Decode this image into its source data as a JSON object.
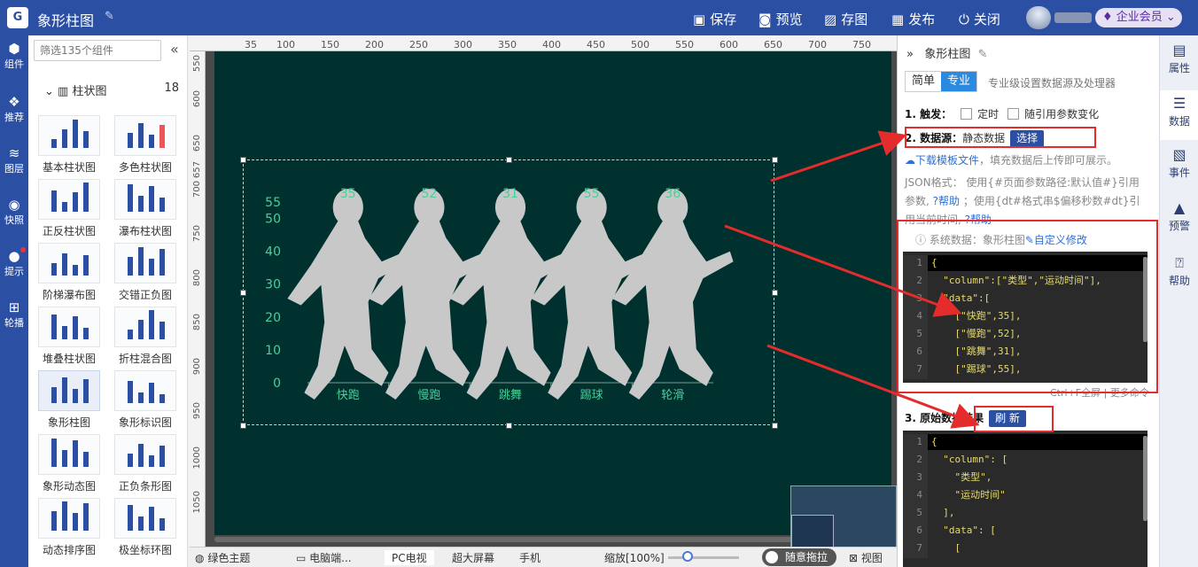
{
  "app": {
    "title": "象形柱图",
    "logo": "G"
  },
  "toolbar": {
    "save": "保存",
    "preview": "预览",
    "snapshot": "存图",
    "publish": "发布",
    "close": "关闭",
    "vip": "企业会员"
  },
  "leftnav": {
    "items": [
      "组件",
      "推荐",
      "图层",
      "快照",
      "提示",
      "轮播"
    ]
  },
  "palette": {
    "search_placeholder": "筛选135个组件",
    "group": "柱状图",
    "group_count": "18",
    "items": [
      "基本柱状图",
      "多色柱状图",
      "正反柱状图",
      "瀑布柱状图",
      "阶梯瀑布图",
      "交错正负图",
      "堆叠柱状图",
      "折柱混合图",
      "象形柱图",
      "象形标识图",
      "象形动态图",
      "正负条形图",
      "动态排序图",
      "极坐标环图"
    ]
  },
  "rulers": {
    "h": [
      "35",
      "100",
      "150",
      "200",
      "250",
      "300",
      "350",
      "400",
      "450",
      "500",
      "550",
      "600",
      "650",
      "700",
      "750"
    ],
    "v": [
      "550",
      "600",
      "650",
      "657",
      "700",
      "750",
      "800",
      "850",
      "900",
      "950",
      "1000",
      "1050"
    ]
  },
  "chart_data": {
    "type": "bar",
    "categories": [
      "快跑",
      "慢跑",
      "跳舞",
      "踢球",
      "轮滑"
    ],
    "values": [
      35,
      52,
      31,
      55,
      36
    ],
    "ylim": [
      0,
      55
    ],
    "yticks": [
      "0",
      "10",
      "20",
      "30",
      "40",
      "50",
      "55"
    ],
    "max": 55,
    "fill_color": "#1a9e6e",
    "empty_color": "#c8c8c8",
    "label_color": "#45d19a"
  },
  "bottombar": {
    "theme": "绿色主题",
    "desktop": "电脑端...",
    "pc_tv": "PC电视",
    "big_screen": "超大屏幕",
    "mobile": "手机",
    "zoom": "缩放[100%]",
    "drag": "随意拖拉",
    "view": "视图"
  },
  "panel": {
    "title": "象形柱图",
    "tab_simple": "简单",
    "tab_pro": "专业",
    "tab_hint": "专业级设置数据源及处理器",
    "trigger_label": "1. 触发：",
    "trigger_timer": "定时",
    "trigger_param": "随引用参数变化",
    "source_label": "2. 数据源：",
    "source_value": "静态数据",
    "source_btn": "选择",
    "download": "下载模板文件",
    "download_tail": "，填充数据后上传即可展示。",
    "json_line1": "JSON格式：  使用{#页面参数路径:默认值#}引用",
    "json_line2a": "参数, ",
    "help": "帮助",
    "json_line2b": " ；使用{dt#格式串$偏移秒数#dt}引",
    "json_line3": "用当前时间, ",
    "sys_data": "系统数据：象形柱图",
    "custom_edit": "自定义修改",
    "code1": [
      "{",
      "  \"column\":[\"类型\",\"运动时间\"],",
      "  \"data\":[",
      "    [\"快跑\",35],",
      "    [\"慢跑\",52],",
      "    [\"跳舞\",31],",
      "    [\"踢球\",55],"
    ],
    "code_footer": "Ctrl+F全屏 | 更多命令",
    "raw_label": "3. 原始数据结果",
    "refresh_btn": "刷 新",
    "code2": [
      "{",
      "  \"column\": [",
      "    \"类型\",",
      "    \"运动时间\"",
      "  ],",
      "  \"data\": [",
      "    ["
    ]
  },
  "rightrail": {
    "items": [
      "属性",
      "数据",
      "事件",
      "预警",
      "帮助"
    ]
  }
}
